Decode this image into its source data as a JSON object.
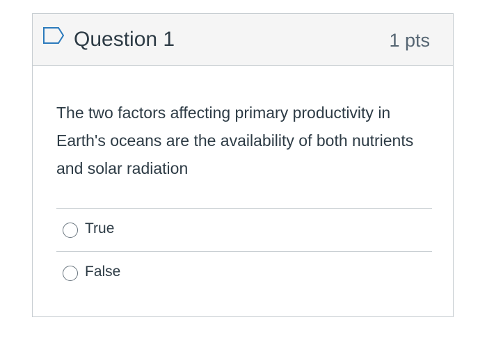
{
  "question": {
    "title": "Question 1",
    "points": "1 pts",
    "flag_icon": "flag-outline-icon",
    "text": "The two factors affecting primary productivity in Earth's oceans are the availability of both nutrients and solar radiation"
  },
  "answers": [
    {
      "label": "True",
      "selected": false
    },
    {
      "label": "False",
      "selected": false
    }
  ],
  "colors": {
    "border": "#c7cdd1",
    "header_background": "#f5f5f5",
    "flag_icon": "#2b7abc",
    "text": "#2d3b45"
  }
}
